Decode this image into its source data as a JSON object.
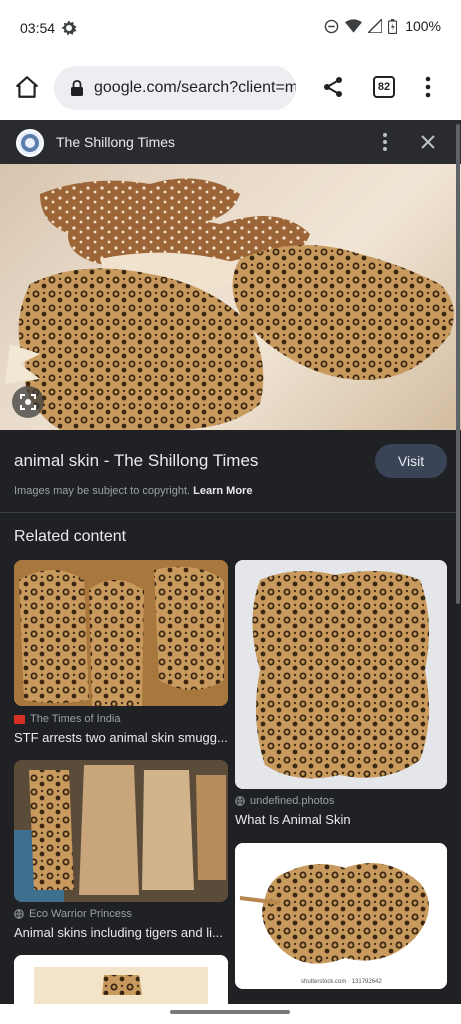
{
  "status_bar": {
    "time": "03:54",
    "battery": "100%"
  },
  "browser": {
    "url": "google.com/search?client=ms",
    "tab_count": "82"
  },
  "panel": {
    "source_name": "The Shillong Times",
    "title": "animal skin - The Shillong Times",
    "visit_label": "Visit",
    "copyright_text": "Images may be subject to copyright.",
    "learn_more_label": "Learn More",
    "related_heading": "Related content"
  },
  "related": [
    {
      "source": "The Times of India",
      "title": "STF arrests two animal skin smugg..."
    },
    {
      "source": "undefined.photos",
      "title": "What Is Animal Skin"
    },
    {
      "source": "Eco Warrior Princess",
      "title": "Animal skins including tigers and li..."
    },
    {
      "source": "shutterstock.com · 131792642",
      "title": ""
    }
  ],
  "colors": {
    "panel_bg": "#202124",
    "visit_bg": "#394457",
    "accent_red": "#d93025"
  }
}
